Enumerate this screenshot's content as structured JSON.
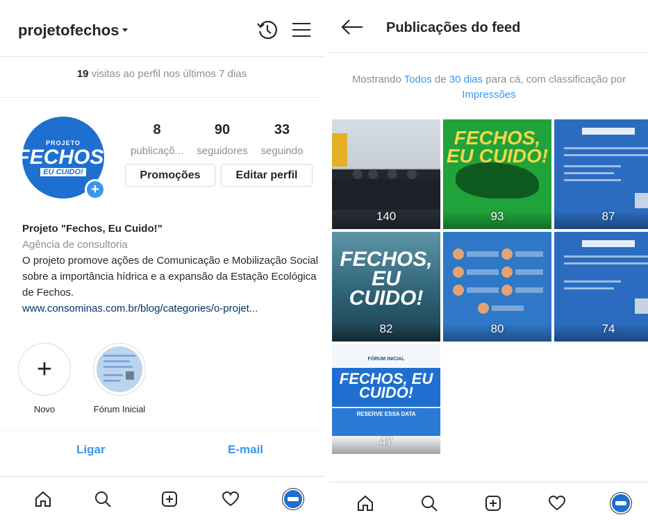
{
  "profile": {
    "username": "projetofechos",
    "visits_count": "19",
    "visits_text": " visitas ao perfil nos últimos 7 dias",
    "avatar_line1": "PROJETO",
    "avatar_line2": "FECHOS,",
    "avatar_line3": "EU CUIDO!",
    "stats": [
      {
        "value": "8",
        "label": "publicaçõ..."
      },
      {
        "value": "90",
        "label": "seguidores"
      },
      {
        "value": "33",
        "label": "seguindo"
      }
    ],
    "buttons": {
      "promotions": "Promoções",
      "edit": "Editar perfil"
    },
    "bio": {
      "name": "Projeto \"Fechos, Eu Cuido!\"",
      "category": "Agência de consultoria",
      "description": "O projeto promove ações de Comunicação e Mobilização Social sobre a importância hídrica e a expansão da Estação Ecológica de Fechos.",
      "link": "www.consominas.com.br/blog/categories/o-projet..."
    },
    "stories": [
      {
        "label": "Novo"
      },
      {
        "label": "Fórum Inicial"
      }
    ],
    "contact": {
      "call": "Ligar",
      "email": "E-mail"
    }
  },
  "feed": {
    "title": "Publicações do feed",
    "filter_prefix": "Mostrando ",
    "filter_all": "Todos",
    "filter_mid": " de ",
    "filter_period": "30 dias",
    "filter_mid2": " para cá, com classificação por ",
    "filter_sort": "Impressões",
    "posts": [
      {
        "count": "140"
      },
      {
        "count": "93",
        "text": "FECHOS, EU CUIDO!"
      },
      {
        "count": "87"
      },
      {
        "count": "82",
        "text": "FECHOS, EU CUIDO!"
      },
      {
        "count": "80"
      },
      {
        "count": "74"
      },
      {
        "count": "47",
        "text": "FECHOS, EU CUIDO!",
        "top_text": "FÓRUM INICIAL",
        "lower_text": "RESERVE ESSA DATA"
      }
    ]
  },
  "nav": [
    "home-icon",
    "search-icon",
    "add-post-icon",
    "heart-icon",
    "profile-avatar"
  ],
  "colors": {
    "accent": "#3897f0",
    "brand": "#1e6fd0",
    "text": "#262626",
    "muted": "#8e8e8e"
  }
}
